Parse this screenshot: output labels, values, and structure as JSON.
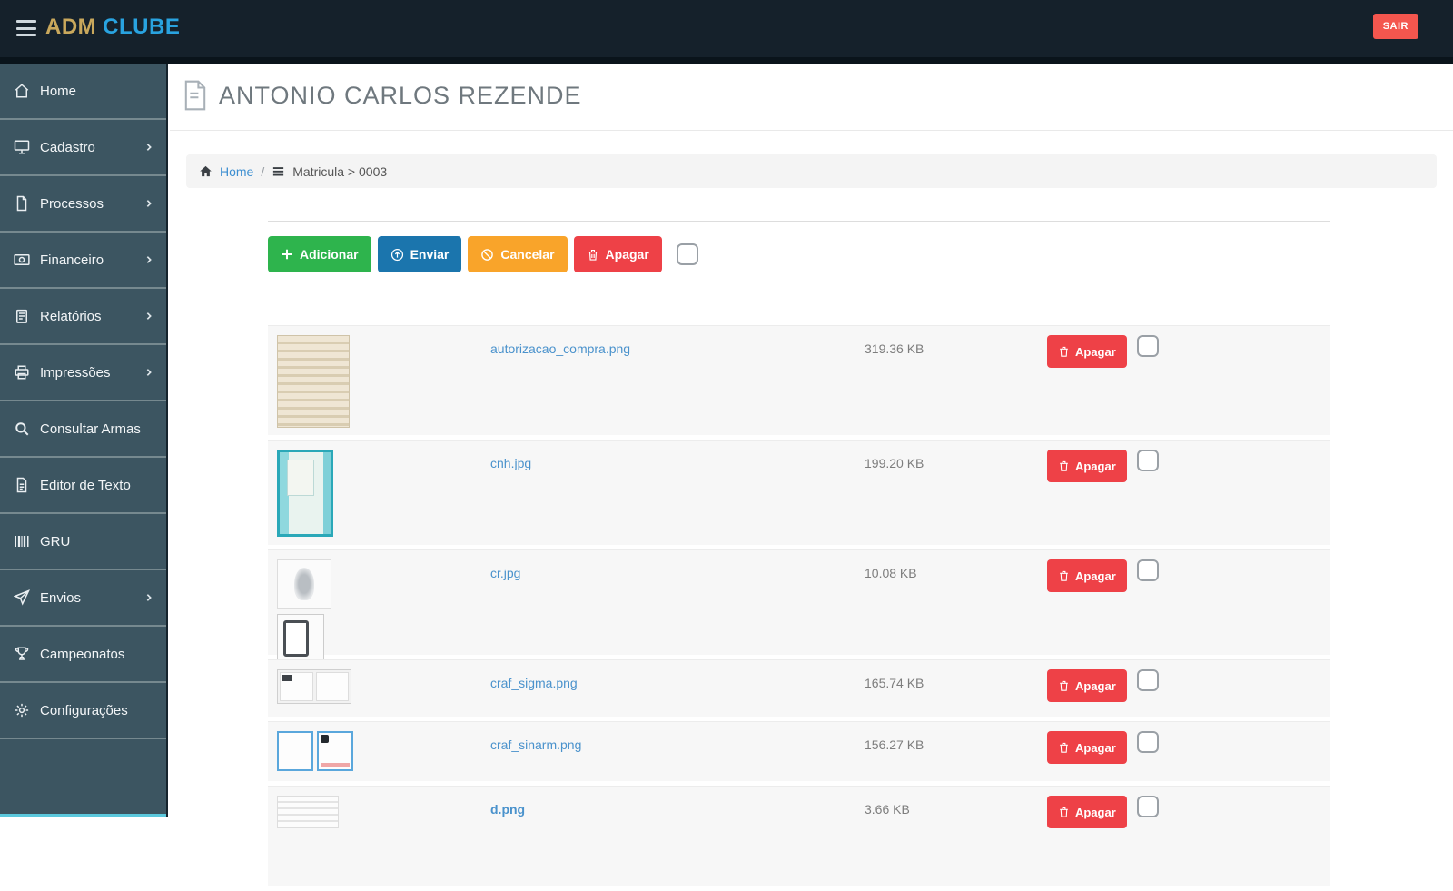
{
  "navbar": {
    "brand_adm": "ADM",
    "brand_clube": "CLUBE",
    "logout_label": "SAIR"
  },
  "sidebar": {
    "items": [
      {
        "label": "Home",
        "icon": "home-icon",
        "has_submenu": false
      },
      {
        "label": "Cadastro",
        "icon": "desktop-icon",
        "has_submenu": true
      },
      {
        "label": "Processos",
        "icon": "file-icon",
        "has_submenu": true
      },
      {
        "label": "Financeiro",
        "icon": "money-icon",
        "has_submenu": true
      },
      {
        "label": "Relatórios",
        "icon": "report-icon",
        "has_submenu": true
      },
      {
        "label": "Impressões",
        "icon": "printer-icon",
        "has_submenu": true
      },
      {
        "label": "Consultar Armas",
        "icon": "search-icon",
        "has_submenu": false
      },
      {
        "label": "Editor de Texto",
        "icon": "file-text-icon",
        "has_submenu": false
      },
      {
        "label": "GRU",
        "icon": "barcode-icon",
        "has_submenu": false
      },
      {
        "label": "Envios",
        "icon": "paper-plane-icon",
        "has_submenu": true
      },
      {
        "label": "Campeonatos",
        "icon": "trophy-icon",
        "has_submenu": false
      },
      {
        "label": "Configurações",
        "icon": "gear-icon",
        "has_submenu": false
      }
    ]
  },
  "page": {
    "title": "ANTONIO CARLOS REZENDE"
  },
  "breadcrumb": {
    "home": "Home",
    "separator": "/",
    "section": "Matricula > 0003"
  },
  "toolbar": {
    "add_label": "Adicionar",
    "send_label": "Enviar",
    "cancel_label": "Cancelar",
    "delete_label": "Apagar"
  },
  "files": {
    "row_delete_label": "Apagar",
    "rows": [
      {
        "filename": "autorizacao_compra.png",
        "size": "319.36 KB",
        "thumb": "beige-document"
      },
      {
        "filename": "cnh.jpg",
        "size": "199.20 KB",
        "thumb": "teal-license"
      },
      {
        "filename": "cr.jpg",
        "size": "10.08 KB",
        "thumb": "certificate-and-card"
      },
      {
        "filename": "craf_sigma.png",
        "size": "165.74 KB",
        "thumb": "two-panel-document"
      },
      {
        "filename": "craf_sinarm.png",
        "size": "156.27 KB",
        "thumb": "blue-framed-document"
      },
      {
        "filename": "d.png",
        "size": "3.66 KB",
        "thumb": "partial-document"
      }
    ]
  },
  "colors": {
    "navbar_bg": "#15212b",
    "sidebar_bg": "#3c5561",
    "brand_gold": "#c9a85c",
    "brand_blue": "#29a3e0",
    "logout_red": "#f4564e",
    "btn_green": "#2eb44d",
    "btn_blue": "#1b75ad",
    "btn_orange": "#f9a42a",
    "btn_red": "#ee4147",
    "link_blue": "#4a92cc"
  }
}
